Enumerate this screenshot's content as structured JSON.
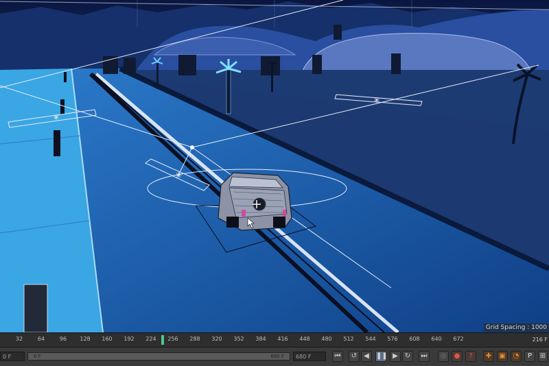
{
  "viewport": {
    "grid_spacing_text": "Grid Spacing : 1000"
  },
  "timeline": {
    "ticks": [
      "32",
      "64",
      "96",
      "128",
      "160",
      "192",
      "224",
      "256",
      "288",
      "320",
      "352",
      "384",
      "416",
      "448",
      "480",
      "512",
      "544",
      "576",
      "608",
      "640",
      "672"
    ],
    "frame_end": "216 F",
    "playhead_frame": 216
  },
  "controls": {
    "start_frame": "0 F",
    "range_start": "0 F",
    "range_end": "680 F",
    "max_frame": "680 F",
    "icons": [
      "go-to-start-icon",
      "step-back-icon",
      "play-reverse-icon",
      "pause-icon",
      "play-forward-icon",
      "step-forward-icon",
      "go-to-end-icon",
      "record-disabled-icon",
      "record-icon",
      "help-icon",
      "move-key-icon",
      "scale-key-icon",
      "rotate-key-icon",
      "param-key-icon",
      "pla-key-icon"
    ]
  },
  "colors": {
    "sky": "#0b1b4a",
    "road": "#1e5fb0",
    "sidewalk": "#3aa6e3",
    "terrain": "#1f3f76",
    "accent_playhead": "#4fc78a",
    "record": "#e0573f",
    "key": "#f08a2c"
  }
}
